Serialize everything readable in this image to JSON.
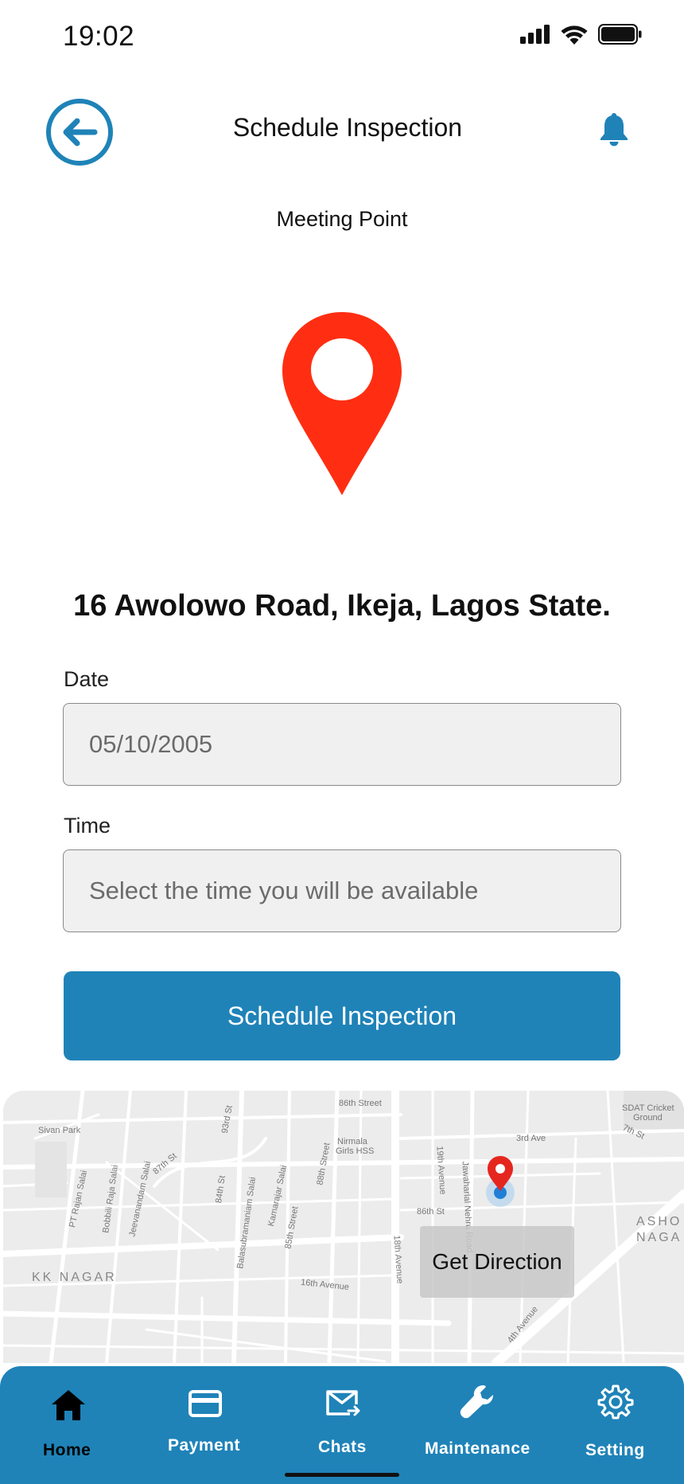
{
  "status_bar": {
    "time": "19:02"
  },
  "header": {
    "title": "Schedule Inspection"
  },
  "meeting_point": {
    "label": "Meeting Point",
    "address": "16 Awolowo Road, Ikeja, Lagos State."
  },
  "form": {
    "date_label": "Date",
    "date_value": "05/10/2005",
    "time_label": "Time",
    "time_placeholder": "Select the time you will be available",
    "submit_label": "Schedule Inspection"
  },
  "map": {
    "get_direction_label": "Get Direction",
    "labels": {
      "street_86th": "86th Street",
      "sdat_cricket": "SDAT Cricket",
      "ground": "Ground",
      "sivan_park": "Sivan Park",
      "nirmala": "Nirmala",
      "girls_hss": "Girls HSS",
      "ave_3rd": "3rd Ave",
      "st_7th": "7th St",
      "st_93rd": "93rd St",
      "ave_19th": "19th Avenue",
      "jawaharlal": "Jawaharlal Nehru Road",
      "st_88th": "88th Street",
      "pt_rajan": "PT Rajan Salai",
      "bobbili": "Bobbili Raja Salai",
      "jeevanandam": "Jeevanandam Salai",
      "st_87th": "87th St",
      "st_84th": "84th St",
      "balasubramaniam": "Balasubramaniam Salai",
      "kamarajar": "Kamarajar Salai",
      "st_85th": "85th Street",
      "st_86th": "86th St",
      "ave_18th": "18th Avenue",
      "kk_nagar": "KK NAGAR",
      "ave_16th": "16th Avenue",
      "asho": "ASHO",
      "naga": "NAGA",
      "ave_4th": "4th Avenue"
    }
  },
  "bottom_nav": {
    "items": [
      {
        "label": "Home",
        "icon": "home-icon",
        "active": true
      },
      {
        "label": "Payment",
        "icon": "credit-card-icon",
        "active": false
      },
      {
        "label": "Chats",
        "icon": "mail-icon",
        "active": false
      },
      {
        "label": "Maintenance",
        "icon": "wrench-icon",
        "active": false
      },
      {
        "label": "Setting",
        "icon": "gear-icon",
        "active": false
      }
    ]
  },
  "colors": {
    "accent": "#1f83b8",
    "pin": "#ff2e12",
    "field_bg": "#f0f0f0"
  }
}
